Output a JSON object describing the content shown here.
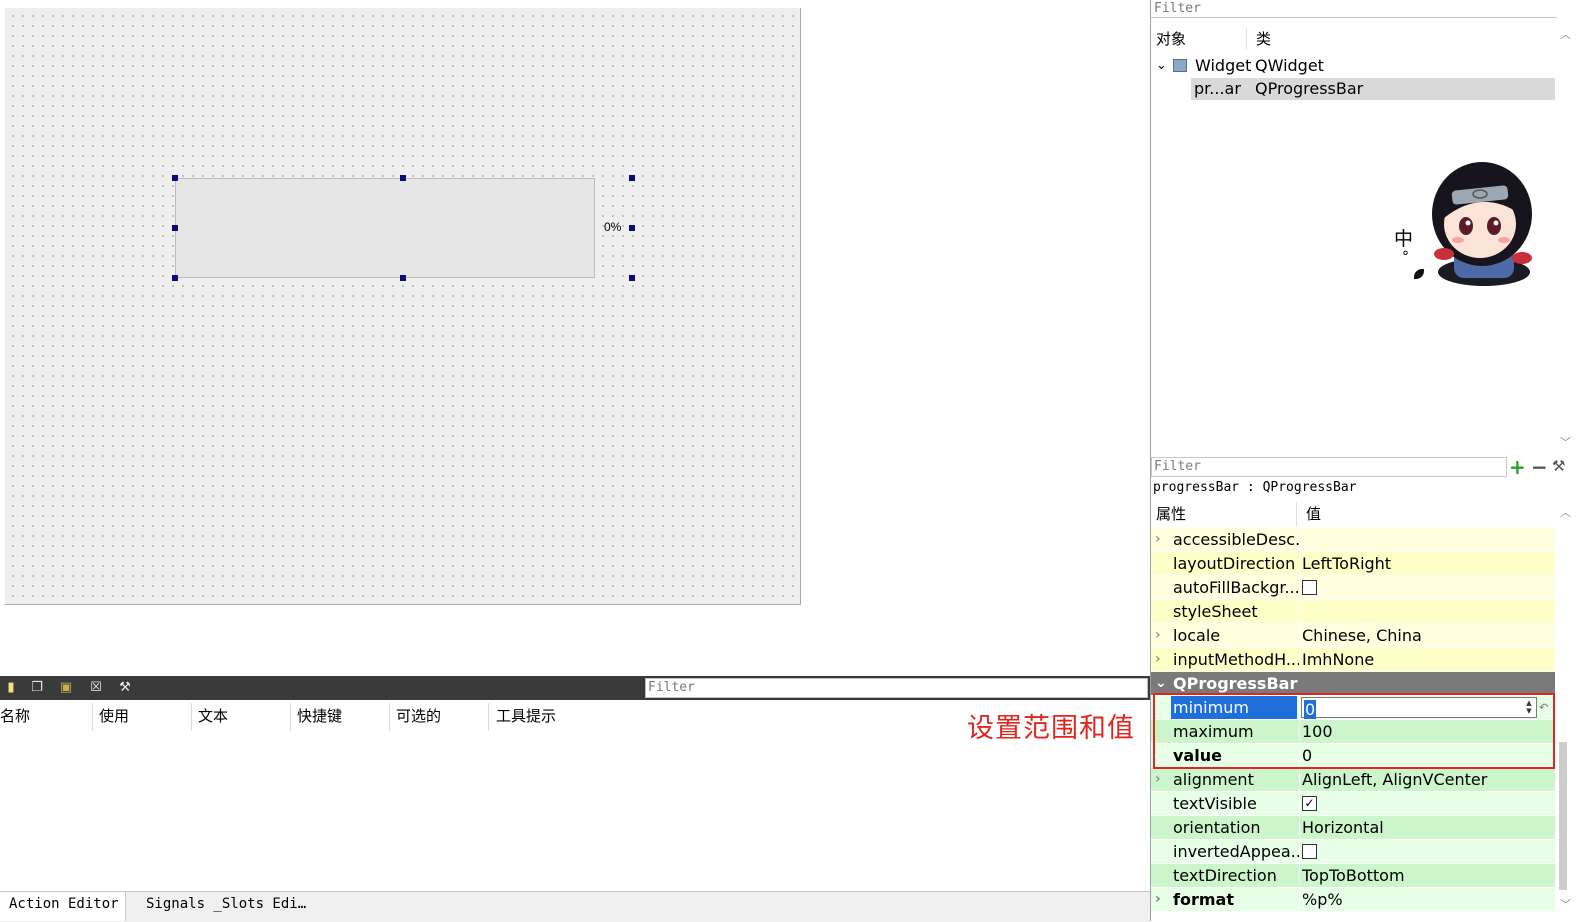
{
  "canvas": {
    "progress_text": "0%"
  },
  "action_editor": {
    "filter_placeholder": "Filter",
    "columns": [
      "名称",
      "使用",
      "文本",
      "快捷键",
      "可选的",
      "工具提示"
    ],
    "tabs": [
      "Action Editor",
      "Signals _Slots Edi…"
    ]
  },
  "annotation": "设置范围和值",
  "object_inspector": {
    "filter_placeholder": "Filter",
    "headers": [
      "对象",
      "类"
    ],
    "rows": [
      {
        "object": "Widget",
        "class": "QWidget"
      },
      {
        "object": "pr...ar",
        "class": "QProgressBar"
      }
    ]
  },
  "ime": {
    "char": "中",
    "dot": "°"
  },
  "property_editor": {
    "filter_placeholder": "Filter",
    "object_name": "progressBar : QProgressBar",
    "headers": [
      "属性",
      "值"
    ],
    "rows": [
      {
        "name": "accessibleDesc...",
        "value": "",
        "expand": "›"
      },
      {
        "name": "layoutDirection",
        "value": "LeftToRight",
        "expand": ""
      },
      {
        "name": "autoFillBackgr...",
        "value": "",
        "expand": "",
        "checkbox": false
      },
      {
        "name": "styleSheet",
        "value": "",
        "expand": ""
      },
      {
        "name": "locale",
        "value": "Chinese, China",
        "expand": "›"
      },
      {
        "name": "inputMethodH...",
        "value": "ImhNone",
        "expand": "›"
      },
      {
        "name": "QProgressBar",
        "value": "",
        "expand": "⌄"
      },
      {
        "name": "minimum",
        "value": "0",
        "expand": ""
      },
      {
        "name": "maximum",
        "value": "100",
        "expand": ""
      },
      {
        "name": "value",
        "value": "0",
        "expand": ""
      },
      {
        "name": "alignment",
        "value": "AlignLeft, AlignVCenter",
        "expand": "›"
      },
      {
        "name": "textVisible",
        "value": "",
        "expand": "",
        "checkbox": true
      },
      {
        "name": "orientation",
        "value": "Horizontal",
        "expand": ""
      },
      {
        "name": "invertedAppea...",
        "value": "",
        "expand": "",
        "checkbox": false
      },
      {
        "name": "textDirection",
        "value": "TopToBottom",
        "expand": ""
      },
      {
        "name": "format",
        "value": "%p%",
        "expand": "›"
      }
    ]
  },
  "colors": {
    "annotation": "#e0261f",
    "selection": "#1e6fd9",
    "property_yellow": "#ffffe0",
    "property_green": "#e6ffe6"
  }
}
